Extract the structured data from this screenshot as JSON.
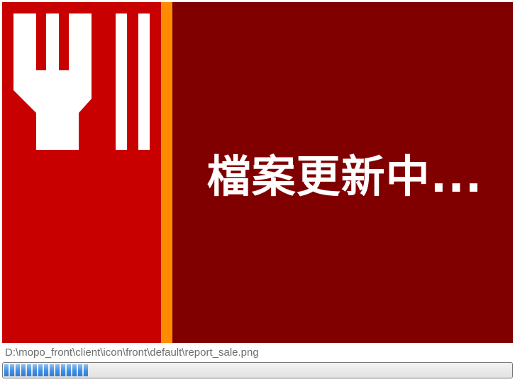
{
  "splash": {
    "status_text": "檔案更新中...",
    "logo_icon": "fork-icon",
    "colors": {
      "left_panel": "#c80000",
      "main_panel": "#800000",
      "accent_stripe": "#ff8c00",
      "text": "#ffffff"
    }
  },
  "status": {
    "file_path": "D:\\mopo_front\\client\\icon\\front\\default\\report_sale.png"
  },
  "progress": {
    "percent": 17,
    "color": "#3b8ee6"
  }
}
